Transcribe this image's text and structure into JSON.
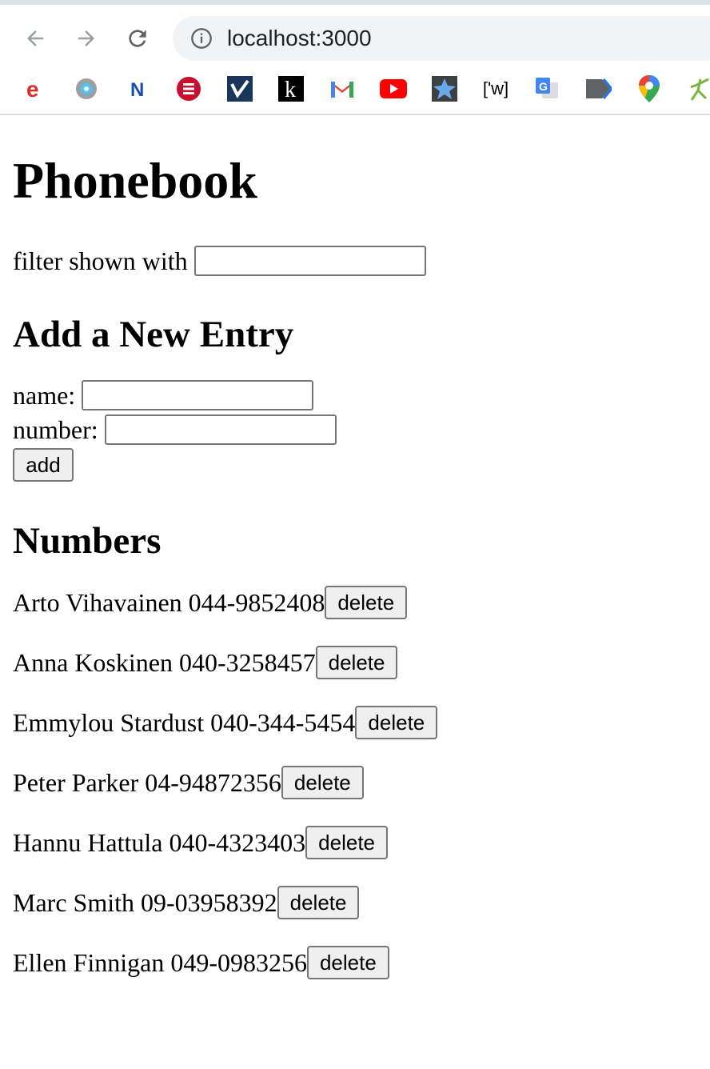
{
  "browser": {
    "url": "localhost:3000",
    "bookmarks": [
      {
        "icon": "e-logo-icon",
        "color": "#d93025"
      },
      {
        "icon": "gear-app-icon",
        "color": "#5f6368"
      },
      {
        "icon": "n-logo-icon",
        "color": "#1a4db3"
      },
      {
        "icon": "red-stack-icon",
        "color": "#c8102e"
      },
      {
        "icon": "check-badge-icon",
        "color": "#1b365d"
      },
      {
        "icon": "k-logo-icon",
        "color": "#000000"
      },
      {
        "icon": "gmail-icon",
        "color": "#ea4335"
      },
      {
        "icon": "youtube-icon",
        "color": "#ff0000"
      },
      {
        "icon": "star-app-icon",
        "color": "#3b78c3"
      },
      {
        "icon": "wiktionary-icon",
        "color": "#000000",
        "text": "['w]"
      },
      {
        "icon": "google-translate-icon",
        "color": "#4285f4"
      },
      {
        "icon": "arrow-tag-icon",
        "color": "#5f6368"
      },
      {
        "icon": "google-maps-icon",
        "color": "#34a853"
      },
      {
        "icon": "leaf-figure-icon",
        "color": "#7cb342"
      }
    ]
  },
  "page": {
    "title": "Phonebook",
    "filter_label": "filter shown with",
    "filter_value": "",
    "add_heading": "Add a New Entry",
    "name_label": "name:",
    "name_value": "",
    "number_label": "number:",
    "number_value": "",
    "add_button": "add",
    "numbers_heading": "Numbers",
    "delete_label": "delete",
    "entries": [
      {
        "name": "Arto Vihavainen",
        "number": "044-9852408"
      },
      {
        "name": "Anna Koskinen",
        "number": "040-3258457"
      },
      {
        "name": "Emmylou Stardust",
        "number": "040-344-5454"
      },
      {
        "name": "Peter Parker",
        "number": "04-94872356"
      },
      {
        "name": "Hannu Hattula",
        "number": "040-4323403"
      },
      {
        "name": "Marc Smith",
        "number": "09-03958392"
      },
      {
        "name": "Ellen Finnigan",
        "number": "049-0983256"
      }
    ]
  }
}
